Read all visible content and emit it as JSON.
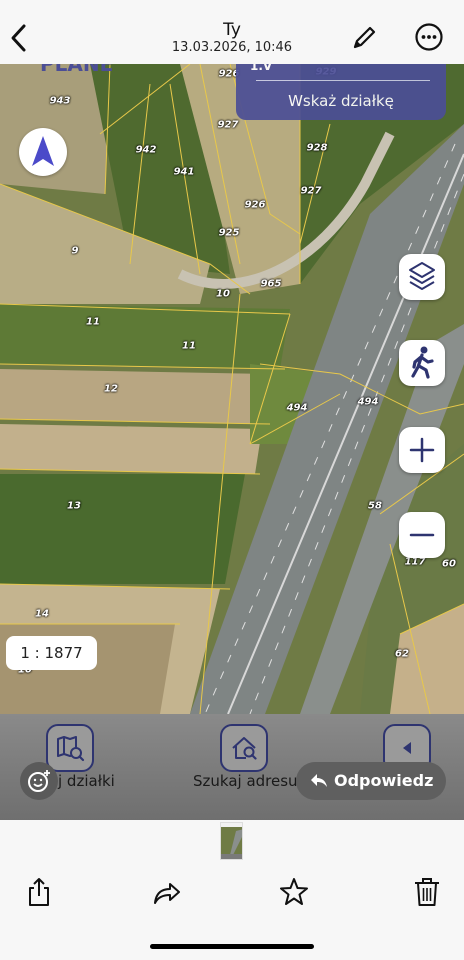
{
  "header": {
    "title": "Ty",
    "subtitle": "13.03.2026, 10:46",
    "back_icon": "chevron-left-icon",
    "edit_icon": "pencil-icon",
    "more_icon": "ellipsis-circle-icon"
  },
  "map": {
    "top_partial_text": "PLANE",
    "wskaz_top_partial": "1.V",
    "wskaz_label": "Wskaż działkę",
    "scale_label": "1 : 1877",
    "parcels": [
      "943",
      "926",
      "929",
      "927",
      "942",
      "941",
      "928",
      "927",
      "926",
      "925",
      "9",
      "965",
      "10",
      "11",
      "11",
      "12",
      "494",
      "494",
      "13",
      "58",
      "117",
      "60",
      "14",
      "62",
      "10"
    ],
    "controls": [
      "layers-icon",
      "pedestrian-icon",
      "zoom-in-icon",
      "zoom-out-icon",
      "compass-arrow-icon"
    ]
  },
  "app_bottom": {
    "search_parcels_label": "j działki",
    "search_address_label": "Szukaj adresu",
    "reply_label": "Odpowiedz"
  },
  "toolbar": {
    "share_icon": "share-icon",
    "forward_icon": "forward-arrow-icon",
    "favorite_icon": "star-icon",
    "delete_icon": "trash-icon"
  },
  "colors": {
    "accent": "#4b4e96",
    "parcel_lines": "#e8c84a"
  }
}
